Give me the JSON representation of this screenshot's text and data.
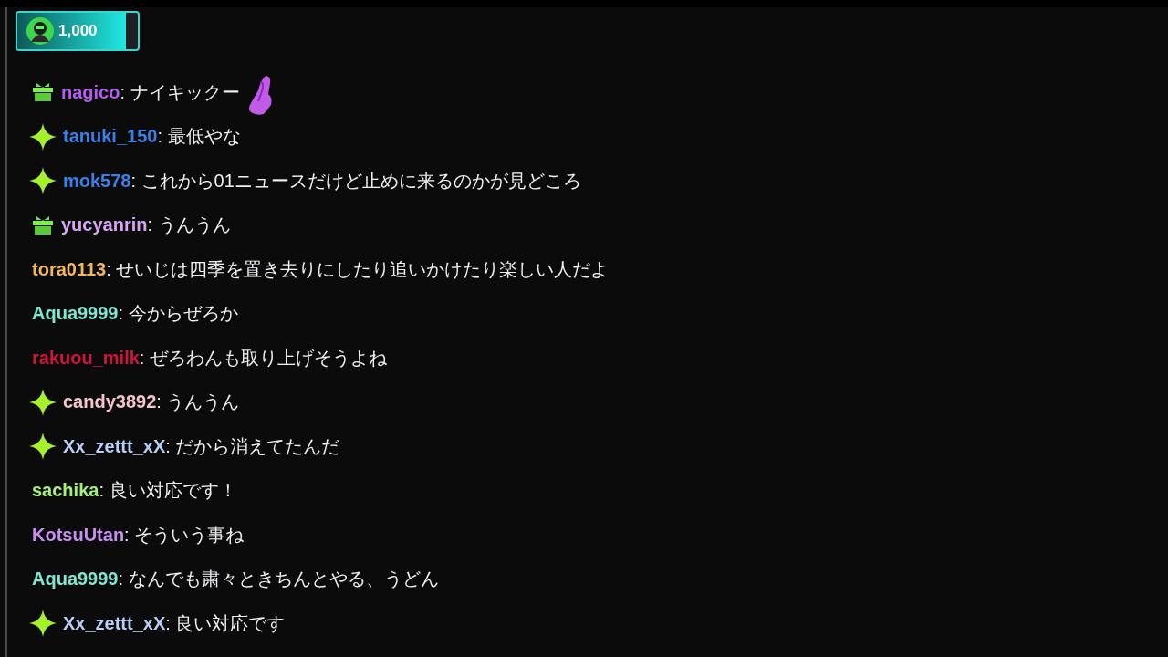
{
  "points_badge": {
    "amount": "1,000",
    "level": 0.9
  },
  "messages": [
    {
      "kind": "gift",
      "user": "nagico",
      "color": "#b45cf2",
      "text": ": ナイキックー",
      "emote": true
    },
    {
      "kind": "sparkle",
      "user": "tanuki_150",
      "color": "#3c7fe6",
      "text": ": 最低やな",
      "emote": false
    },
    {
      "kind": "sparkle",
      "user": "mok578",
      "color": "#3c7fe6",
      "text": ": これから01ニュースだけど止めに来るのかが見どころ",
      "emote": false
    },
    {
      "kind": "gift",
      "user": "yucyanrin",
      "color": "#d6a6f2",
      "text": ": うんうん",
      "emote": false
    },
    {
      "kind": "plain",
      "user": "tora0113",
      "color": "#f2b85c",
      "text": ": せいじは四季を置き去りにしたり追いかけたり楽しい人だよ",
      "emote": false
    },
    {
      "kind": "plain",
      "user": "Aqua9999",
      "color": "#80e6d0",
      "text": ": 今からぜろか",
      "emote": false
    },
    {
      "kind": "plain",
      "user": "rakuou_milk",
      "color": "#d0143c",
      "text": ": ぜろわんも取り上げそうよね",
      "emote": false
    },
    {
      "kind": "sparkle",
      "user": "candy3892",
      "color": "#f4c4cc",
      "text": ": うんうん",
      "emote": false
    },
    {
      "kind": "sparkle",
      "user": "Xx_zettt_xX",
      "color": "#b8cef4",
      "text": ": だから消えてたんだ",
      "emote": false
    },
    {
      "kind": "plain",
      "user": "sachika",
      "color": "#a6f07a",
      "text": ": 良い対応です！",
      "emote": false
    },
    {
      "kind": "plain",
      "user": "KotsuUtan",
      "color": "#c88ff2",
      "text": ": そういう事ね",
      "emote": false
    },
    {
      "kind": "plain",
      "user": "Aqua9999",
      "color": "#80e6d0",
      "text": ": なんでも粛々ときちんとやる、うどん",
      "emote": false
    },
    {
      "kind": "sparkle",
      "user": "Xx_zettt_xX",
      "color": "#b8cef4",
      "text": ": 良い対応です",
      "emote": false
    }
  ]
}
